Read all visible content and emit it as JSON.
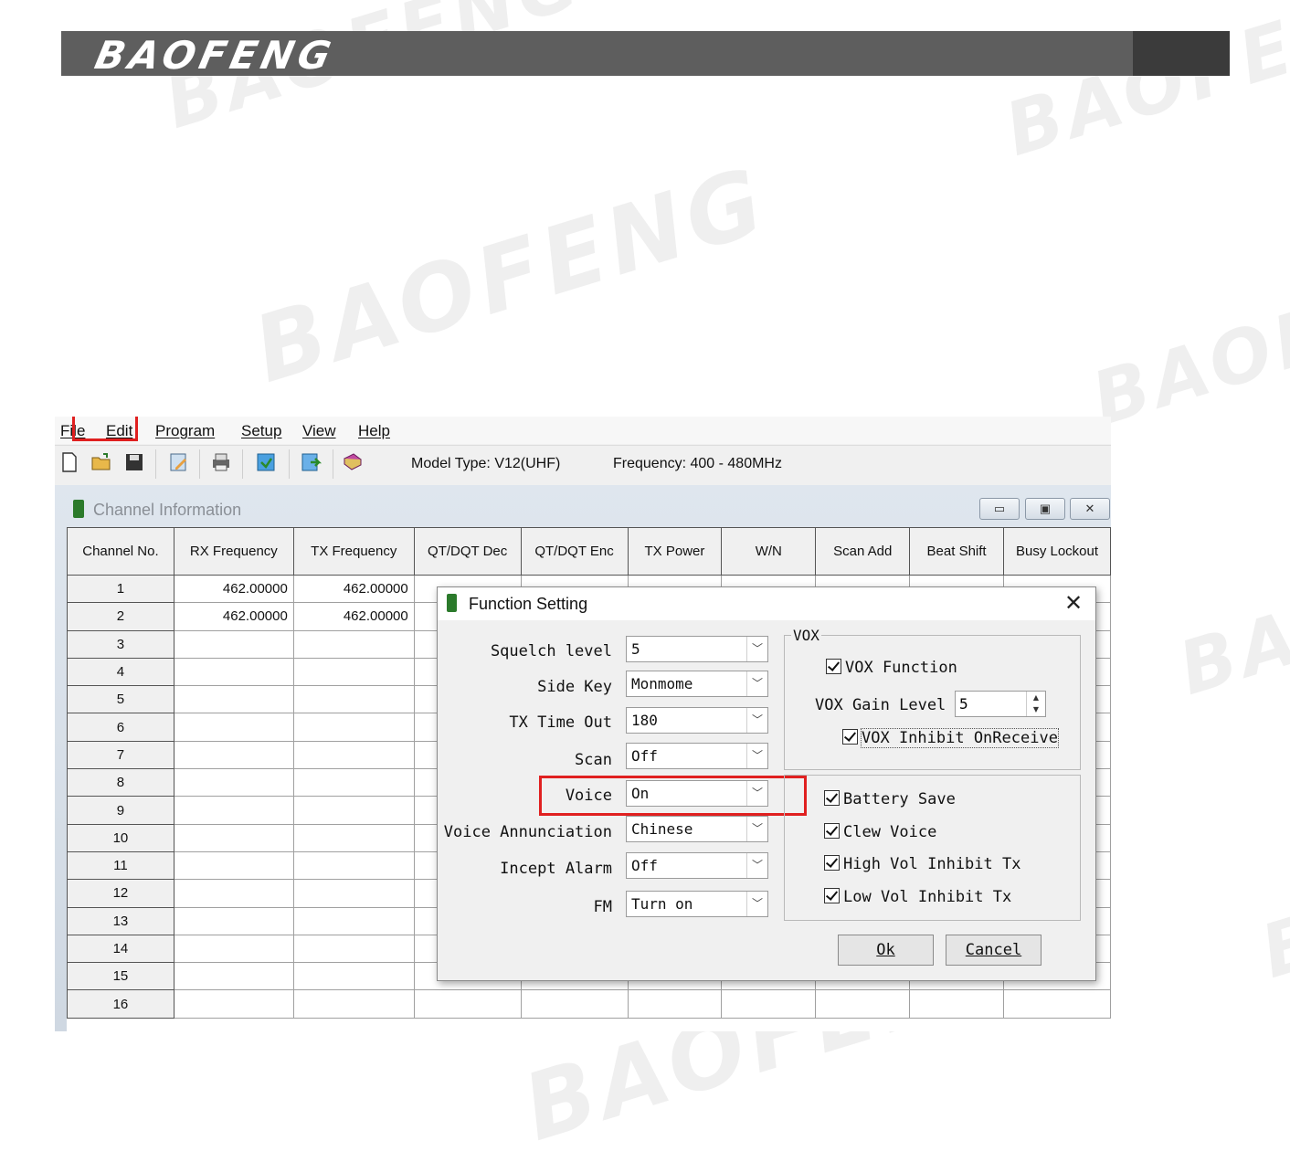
{
  "banner": {
    "logo": "BAOFENG"
  },
  "watermarks": [
    "BAOFENG",
    "BAOFENG",
    "BAOFENG",
    "BAOFENG",
    "BAOFENG",
    "BAOFENG",
    "BAOFENG"
  ],
  "menubar": {
    "items": [
      "File",
      "Edit",
      "Program",
      "Setup",
      "View",
      "Help"
    ],
    "highlighted": "Edit"
  },
  "toolbar": {
    "icons": [
      "new-icon",
      "open-folder-icon",
      "save-icon",
      "edit-icon",
      "print-icon",
      "read-icon",
      "write-icon",
      "book-icon"
    ],
    "model_type": "Model Type: V12(UHF)",
    "frequency": "Frequency: 400 - 480MHz"
  },
  "channel_window": {
    "title": "Channel Information",
    "buttons": [
      "minimize",
      "restore",
      "close"
    ],
    "columns": [
      "Channel No.",
      "RX Frequency",
      "TX Frequency",
      "QT/DQT Dec",
      "QT/DQT Enc",
      "TX Power",
      "W/N",
      "Scan Add",
      "Beat Shift",
      "Busy Lockout"
    ],
    "rows": [
      {
        "no": "1",
        "rx": "462.00000",
        "tx": "462.00000"
      },
      {
        "no": "2",
        "rx": "462.00000",
        "tx": "462.00000"
      },
      {
        "no": "3",
        "rx": "",
        "tx": ""
      },
      {
        "no": "4",
        "rx": "",
        "tx": ""
      },
      {
        "no": "5",
        "rx": "",
        "tx": ""
      },
      {
        "no": "6",
        "rx": "",
        "tx": ""
      },
      {
        "no": "7",
        "rx": "",
        "tx": ""
      },
      {
        "no": "8",
        "rx": "",
        "tx": ""
      },
      {
        "no": "9",
        "rx": "",
        "tx": ""
      },
      {
        "no": "10",
        "rx": "",
        "tx": ""
      },
      {
        "no": "11",
        "rx": "",
        "tx": ""
      },
      {
        "no": "12",
        "rx": "",
        "tx": ""
      },
      {
        "no": "13",
        "rx": "",
        "tx": ""
      },
      {
        "no": "14",
        "rx": "",
        "tx": ""
      },
      {
        "no": "15",
        "rx": "",
        "tx": ""
      },
      {
        "no": "16",
        "rx": "",
        "tx": ""
      }
    ]
  },
  "dialog": {
    "title": "Function Setting",
    "close": "✕",
    "fields": [
      {
        "label": "Squelch level",
        "value": "5"
      },
      {
        "label": "Side Key",
        "value": "Monmome"
      },
      {
        "label": "TX Time Out",
        "value": "180"
      },
      {
        "label": "Scan",
        "value": "Off"
      },
      {
        "label": "Voice",
        "value": "On"
      },
      {
        "label": "Voice Annunciation",
        "value": "Chinese"
      },
      {
        "label": "Incept Alarm",
        "value": "Off"
      },
      {
        "label": "FM",
        "value": "Turn on"
      }
    ],
    "vox": {
      "legend": "VOX",
      "function": "VOX Function",
      "gain_label": "VOX Gain Level",
      "gain_value": "5",
      "inhibit": "VOX Inhibit OnReceive"
    },
    "options": [
      "Battery Save",
      "Clew Voice",
      "High Vol Inhibit Tx",
      "Low Vol Inhibit Tx"
    ],
    "ok": "Ok",
    "cancel": "Cancel",
    "highlighted_field": "Voice"
  },
  "colors": {
    "banner": "#5e5e5e",
    "highlight": "#e02020"
  }
}
